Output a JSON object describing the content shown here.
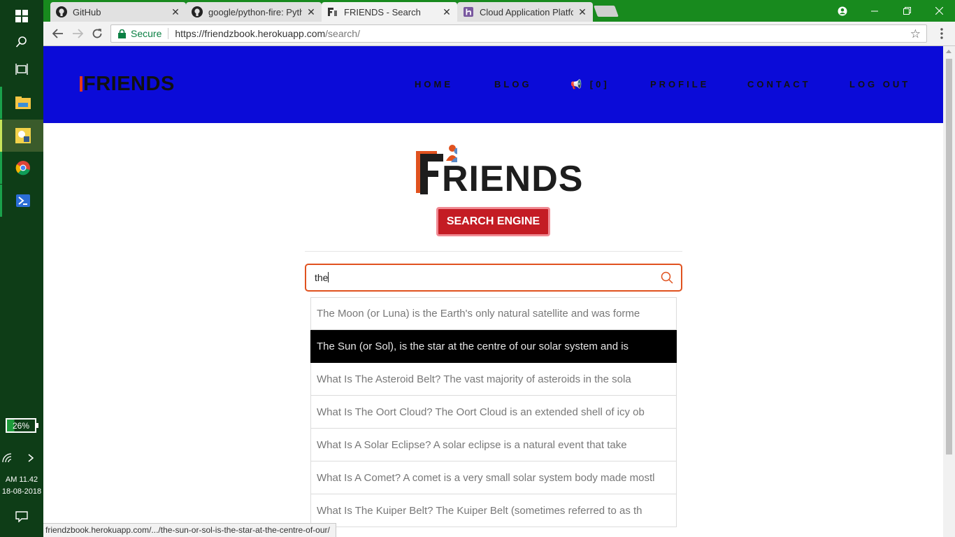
{
  "taskbar": {
    "apps": [
      {
        "name": "file-explorer",
        "state": "open"
      },
      {
        "name": "python-idle",
        "state": "active"
      },
      {
        "name": "chrome",
        "state": "open"
      },
      {
        "name": "powershell",
        "state": "open"
      }
    ],
    "battery": "26%",
    "time": "AM 11.42",
    "date": "18-08-2018"
  },
  "browser": {
    "tabs": [
      {
        "title": "GitHub",
        "icon": "github-icon",
        "active": false
      },
      {
        "title": "google/python-fire: Pyth",
        "icon": "github-icon",
        "active": false
      },
      {
        "title": "FRIENDS - Search",
        "icon": "friends-favicon",
        "active": true
      },
      {
        "title": "Cloud Application Platfor",
        "icon": "heroku-icon",
        "active": false
      }
    ],
    "secure_label": "Secure",
    "url_host": "https://friendzbook.herokuapp.com",
    "url_path": "/search/",
    "status_url": "friendzbook.herokuapp.com/.../the-sun-or-sol-is-the-star-at-the-centre-of-our/",
    "colors": {
      "tabstrip": "#188a1e",
      "header": "#0b0bd8",
      "accent": "#e0521f",
      "badge": "#c41c24"
    }
  },
  "site": {
    "brand": "FRIENDS",
    "nav": [
      "HOME",
      "BLOG",
      "📢 [0]",
      "PROFILE",
      "CONTACT",
      "LOG OUT"
    ],
    "logo_text": "RIENDS",
    "badge": "SEARCH ENGINE",
    "search_value": "the",
    "results": [
      "The Moon (or Luna) is the Earth's only natural satellite and was forme",
      "The Sun (or Sol), is the star at the centre of our solar system and is",
      "What Is The Asteroid Belt? The vast majority of asteroids in the sola",
      "What Is The Oort Cloud? The Oort Cloud is an extended shell of icy ob",
      "What Is A Solar Eclipse? A solar eclipse is a natural event that take",
      "What Is A Comet? A comet is a very small solar system body made mostl",
      "What Is The Kuiper Belt? The Kuiper Belt (sometimes referred to as th"
    ],
    "highlighted_index": 1
  }
}
